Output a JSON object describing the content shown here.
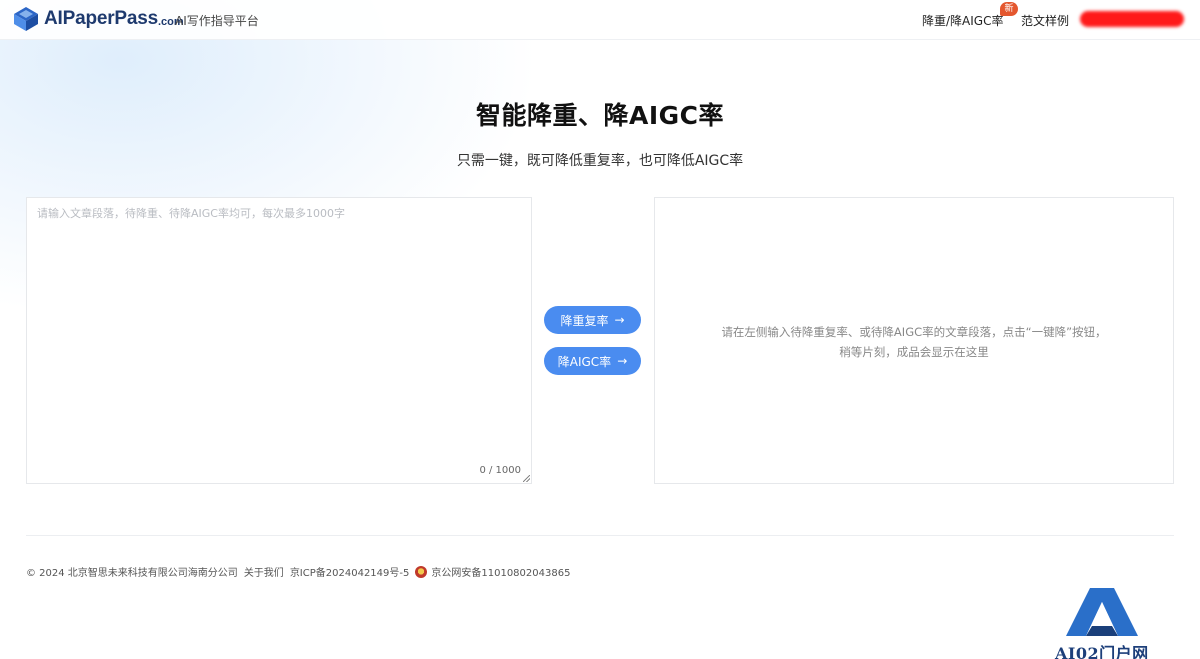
{
  "header": {
    "brand": "AIPaperPass",
    "brand_suffix": ".com",
    "tagline": "AI写作指导平台",
    "nav": {
      "jiang": "降重/降AIGC率",
      "new_badge": "新",
      "sample": "范文样例"
    }
  },
  "hero": {
    "title": "智能降重、降AIGC率",
    "subtitle": "只需一键，既可降低重复率，也可降低AIGC率"
  },
  "editor": {
    "placeholder": "请输入文章段落，待降重、待降AIGC率均可，每次最多1000字",
    "counter": "0 / 1000"
  },
  "actions": {
    "dup_label": "降重复率",
    "aigc_label": "降AIGC率",
    "arrow": "→"
  },
  "output": {
    "hint_line1": "请在左侧输入待降重复率、或待降AIGC率的文章段落，点击“一键降”按钮，",
    "hint_line2": "稍等片刻，成品会显示在这里"
  },
  "footer": {
    "copyright": "© 2024 北京智思未来科技有限公司海南分公司",
    "about": "关于我们",
    "icp": "京ICP备2024042149号-5",
    "police": "京公网安备11010802043865"
  },
  "watermark": {
    "text": "AI02门户网"
  },
  "colors": {
    "accent": "#4a8cf0",
    "brand": "#1e3a6e",
    "badge": "#e4572e"
  },
  "icons": {
    "logo": "layered-book-logo-icon",
    "police": "police-badge-icon",
    "arrow": "arrow-right-icon"
  }
}
